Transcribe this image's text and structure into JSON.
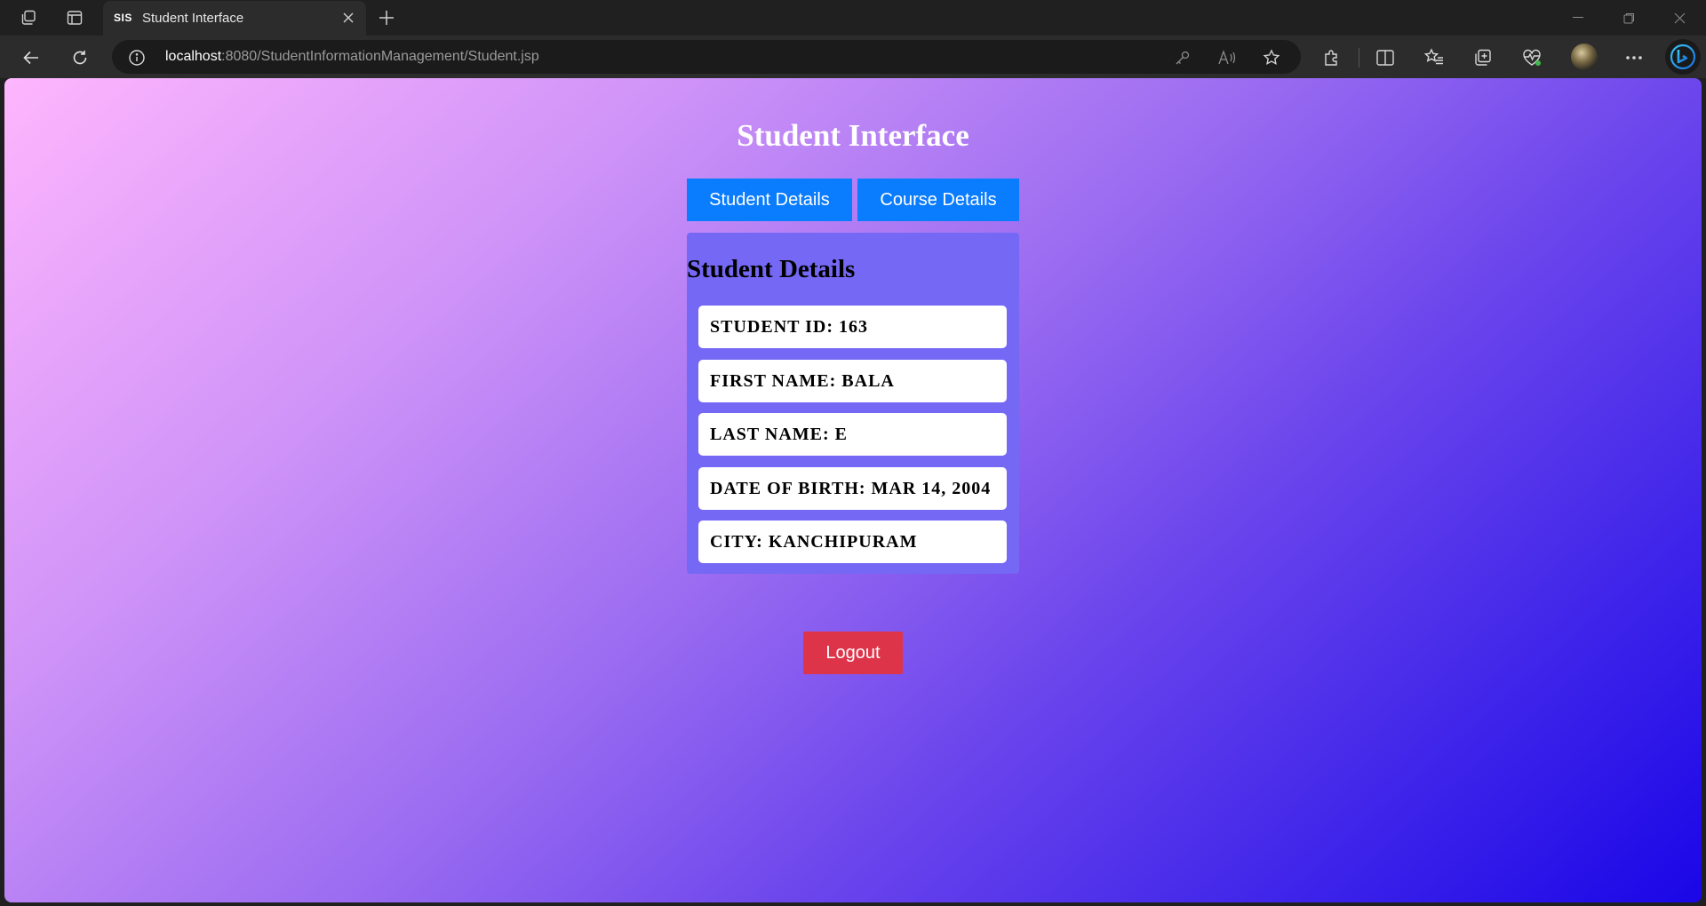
{
  "browser": {
    "tab": {
      "favicon_text": "SIS",
      "title": "Student Interface"
    },
    "address": {
      "host": "localhost",
      "path": ":8080/StudentInformationManagement/Student.jsp"
    }
  },
  "page": {
    "title": "Student Interface",
    "tabs": [
      {
        "label": "Student Details"
      },
      {
        "label": "Course Details"
      }
    ],
    "student_details": {
      "heading": "Student Details",
      "fields": [
        {
          "label": "Student ID",
          "value": "163",
          "text": "Student ID: 163"
        },
        {
          "label": "First Name",
          "value": "Bala",
          "text": "First Name: Bala"
        },
        {
          "label": "Last Name",
          "value": "E",
          "text": "Last Name: E"
        },
        {
          "label": "Date of Birth",
          "value": "Mar 14, 2004",
          "text": "Date of Birth: Mar 14, 2004"
        },
        {
          "label": "City",
          "value": "Kanchipuram",
          "text": "City: Kanchipuram"
        }
      ]
    },
    "logout_label": "Logout"
  },
  "icons": {
    "workspaces": "workspaces-icon",
    "tab_actions": "tab-actions-icon",
    "close": "close-icon",
    "new_tab": "plus-icon",
    "back": "back-arrow-icon",
    "refresh": "refresh-icon",
    "site_info": "info-icon",
    "password": "key-icon",
    "read_aloud": "read-aloud-icon",
    "favorite": "star-icon",
    "extensions": "puzzle-icon",
    "split_screen": "split-screen-icon",
    "favorites": "favorites-icon",
    "collections": "collections-icon",
    "health": "heartbeat-icon",
    "more": "more-icon",
    "copilot": "copilot-icon"
  },
  "colors": {
    "tab_button": "#0a7cfe",
    "logout_button": "#de3449",
    "panel": "#7468f5",
    "gradient_start": "#feb6fd",
    "gradient_end": "#1a06e7"
  }
}
